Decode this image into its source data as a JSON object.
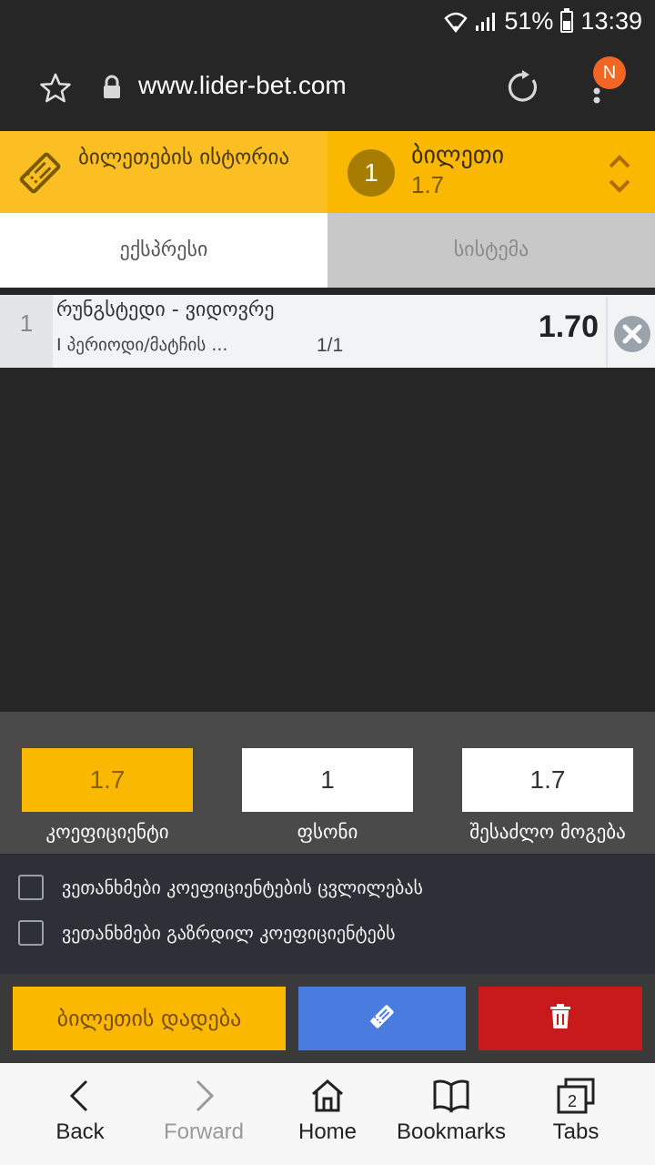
{
  "status_bar": {
    "battery": "51%",
    "time": "13:39"
  },
  "browser": {
    "url": "www.lider-bet.com",
    "notification_badge": "N"
  },
  "ticket_header": {
    "history_label": "ბილეთების ისტორია",
    "ticket_count": "1",
    "ticket_title": "ბილეთი",
    "ticket_odds": "1.7"
  },
  "tabs": [
    {
      "label": "ექსპრესი",
      "active": true
    },
    {
      "label": "სისტემა",
      "active": false
    }
  ],
  "bets": [
    {
      "index": "1",
      "match": "რუნგსტედი - ვიდოვრე",
      "market": "I პერიოდი/მატჩის ...",
      "count": "1/1",
      "odds": "1.70"
    }
  ],
  "summary": {
    "coefficient": {
      "value": "1.7",
      "label": "კოეფიციენტი"
    },
    "stake": {
      "value": "1",
      "label": "ფსონი"
    },
    "possible_win": {
      "value": "1.7",
      "label": "შესაძლო მოგება"
    }
  },
  "agreements": [
    {
      "label": "ვეთანხმები კოეფიციენტების ცვლილებას",
      "checked": false
    },
    {
      "label": "ვეთანხმები გაზრდილ კოეფიციენტებს",
      "checked": false
    }
  ],
  "actions": {
    "place_bet_label": "ბილეთის დადება"
  },
  "browser_nav": [
    {
      "label": "Back",
      "icon": "chevron-left-icon",
      "enabled": true
    },
    {
      "label": "Forward",
      "icon": "chevron-right-icon",
      "enabled": false
    },
    {
      "label": "Home",
      "icon": "home-icon",
      "enabled": true
    },
    {
      "label": "Bookmarks",
      "icon": "book-icon",
      "enabled": true
    },
    {
      "label": "Tabs",
      "icon": "tabs-icon",
      "enabled": true,
      "tab_count": "2"
    }
  ],
  "colors": {
    "accent": "#fbb800",
    "save_blue": "#4a7ce0",
    "delete_red": "#c81a1a"
  }
}
